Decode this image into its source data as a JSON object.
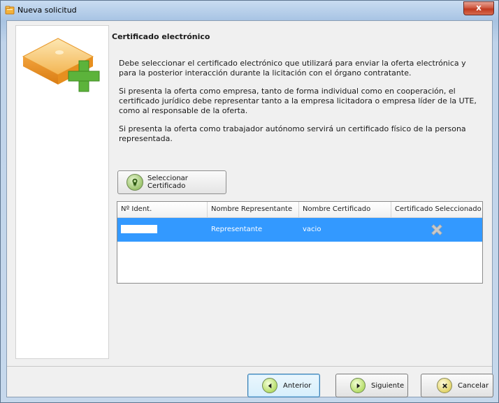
{
  "window": {
    "title": "Nueva solicitud",
    "close_label": "x",
    "icon": "folder-icon"
  },
  "header": {
    "title": "Certificado electrónico"
  },
  "paragraphs": [
    "Debe seleccionar el certificado electrónico que utilizará para enviar la oferta electrónica y para la posterior interacción durante la licitación con el órgano contratante.",
    "Si presenta la oferta como empresa, tanto de forma individual como en cooperación, el certificado jurídico debe representar tanto a la empresa licitadora o empresa líder de la UTE, como al responsable de la oferta.",
    "Si presenta la oferta como trabajador autónomo servirá un certificado físico de la persona representada."
  ],
  "select_button": {
    "label": "Seleccionar Certificado",
    "icon": "certificate-icon"
  },
  "table": {
    "columns": [
      "Nº Ident.",
      "Nombre Representante",
      "Nombre Certificado",
      "Certificado Seleccionado"
    ],
    "rows": [
      {
        "id": "",
        "representante": "Representante",
        "certificado": "vacio",
        "seleccionado_icon": "x-mark-icon"
      }
    ]
  },
  "buttons": {
    "back": "Anterior",
    "next": "Siguiente",
    "cancel": "Cancelar"
  },
  "colors": {
    "selection": "#3399ff",
    "accent_green": "#5cb33b",
    "box_orange": "#f2a23c"
  }
}
